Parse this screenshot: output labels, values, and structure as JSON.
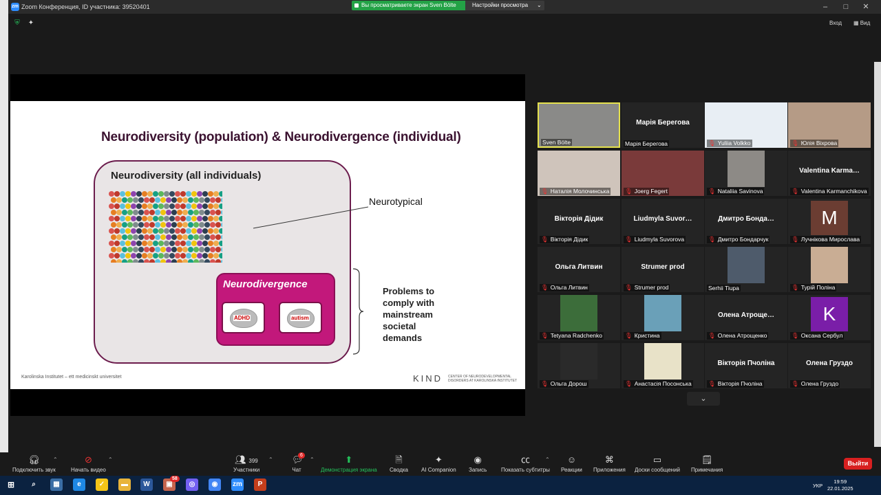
{
  "window": {
    "title": "Zoom Конференция, ID участника: 39520401",
    "app_icon": "zm",
    "share_notice": "Вы просматриваете экран Sven Bölte",
    "view_options": "Настройки просмотра",
    "enter_label": "Вход",
    "view_label": "Вид"
  },
  "slide": {
    "title": "Neurodiversity (population) & Neurodivergence (individual)",
    "box_label": "Neurodiversity (all individuals)",
    "neurotypical": "Neurotypical",
    "neurodivergence": "Neurodivergence",
    "brain1": "ADHD",
    "brain2": "autism",
    "problems": "Problems to\ncomply with\nmainstream\nsocietal\ndemands",
    "footer": "Karolinska Institutet – ett medicinskt universitet",
    "logo": "KIND",
    "logo_sub": "CENTER OF NEURODEVELOPMENTAL DISORDERS AT KAROLINSKA INSTITUTET"
  },
  "gallery": [
    {
      "name": "Sven Bölte",
      "display": "",
      "type": "video",
      "muted": false,
      "active": true,
      "color": "#8a8a88"
    },
    {
      "name": "Марія Берегова",
      "display": "Марія Берегова",
      "type": "name",
      "muted": false
    },
    {
      "name": "Yuliia Volkko",
      "display": "",
      "type": "video",
      "muted": true,
      "color": "#e8eef4"
    },
    {
      "name": "Юлія Віхрова",
      "display": "",
      "type": "video",
      "muted": true,
      "color": "#b59b86"
    },
    {
      "name": "Наталія Молочинська",
      "display": "",
      "type": "video",
      "muted": true,
      "color": "#cfc4bb"
    },
    {
      "name": "Joerg Fegert",
      "display": "",
      "type": "video",
      "muted": true,
      "color": "#7a3a3a"
    },
    {
      "name": "Nataliia Savinova",
      "display": "",
      "type": "photo",
      "muted": true,
      "color": "#8d8a86"
    },
    {
      "name": "Valentina Karmanchikova",
      "display": "Valentina  Karma…",
      "type": "name",
      "muted": true
    },
    {
      "name": "Вікторія Дідик",
      "display": "Вікторія Дідик",
      "type": "name",
      "muted": true
    },
    {
      "name": "Liudmyla Suvorova",
      "display": "Liudmyla  Suvor…",
      "type": "name",
      "muted": true
    },
    {
      "name": "Дмитро Бондарчук",
      "display": "Дмитро  Бонда…",
      "type": "name",
      "muted": true
    },
    {
      "name": "Лучнікова Мирослава",
      "display": "M",
      "type": "avatar",
      "muted": true,
      "color": "#6b3d32"
    },
    {
      "name": "Ольга Литвин",
      "display": "Ольга Литвин",
      "type": "name",
      "muted": true
    },
    {
      "name": "Strumer prod",
      "display": "Strumer prod",
      "type": "name",
      "muted": true
    },
    {
      "name": "Serhii Tiupa",
      "display": "",
      "type": "photo",
      "muted": false,
      "color": "#4e5b6b"
    },
    {
      "name": "Турій Поліна",
      "display": "",
      "type": "photo",
      "muted": true,
      "color": "#c9ad94"
    },
    {
      "name": "Tetyana Radchenko",
      "display": "",
      "type": "photo",
      "muted": true,
      "color": "#3c6d3a"
    },
    {
      "name": "Кристина",
      "display": "",
      "type": "photo",
      "muted": true,
      "color": "#6aa0b8"
    },
    {
      "name": "Олена Атрощенко",
      "display": "Олена  Атроще…",
      "type": "name",
      "muted": true
    },
    {
      "name": "Оксана Сербул",
      "display": "K",
      "type": "avatar",
      "muted": true,
      "color": "#7a1ea8"
    },
    {
      "name": "Ольга Дорош",
      "display": "",
      "type": "photo",
      "muted": true,
      "color": "#2a2a2a"
    },
    {
      "name": "Анастасія Посонська",
      "display": "",
      "type": "photo",
      "muted": true,
      "color": "#e8e2c8"
    },
    {
      "name": "Вікторія Пчоліна",
      "display": "Вікторія Пчоліна",
      "type": "name",
      "muted": true
    },
    {
      "name": "Олена Груздо",
      "display": "Олена Груздо",
      "type": "name",
      "muted": true
    }
  ],
  "controls": {
    "audio": "Подключить звук",
    "video": "Начать видео",
    "participants": "Участники",
    "participants_count": "399",
    "chat": "Чат",
    "chat_badge": "6",
    "share": "Демонстрация экрана",
    "notes": "Сводка",
    "ai": "AI Companion",
    "record": "Запись",
    "captions": "Показать субтитры",
    "reactions": "Реакции",
    "apps": "Приложения",
    "whiteboards": "Доски сообщений",
    "notes2": "Примечания",
    "leave": "Выйти"
  },
  "taskbar": {
    "time": "19:59",
    "date": "22.01.2025",
    "lang": "УКР",
    "items": [
      "search-icon",
      "calculator-icon",
      "edge-icon",
      "norton-icon",
      "folder-icon",
      "word-icon",
      "photos-icon",
      "viber-icon",
      "chrome-icon",
      "zoom-icon",
      "powerpoint-icon"
    ],
    "badge_photos": "58"
  },
  "colors": {
    "slide_accent": "#c2187b",
    "slide_dark": "#3b1230",
    "share_green": "#23a246",
    "leave_red": "#d82020",
    "active_border": "#e6e24e"
  }
}
